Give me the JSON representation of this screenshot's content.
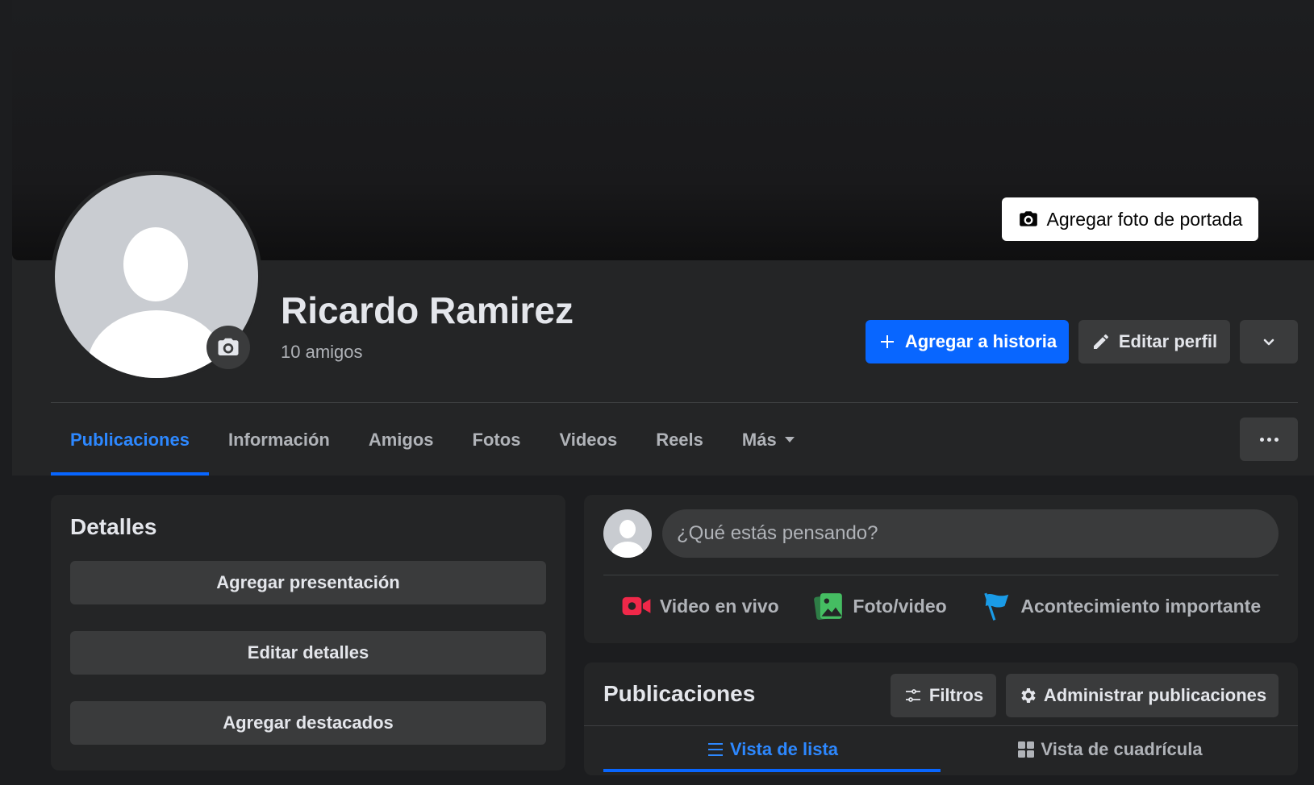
{
  "cover": {
    "add_cover_photo_label": "Agregar foto de portada"
  },
  "profile": {
    "name": "Ricardo Ramirez",
    "friends_count": "10 amigos"
  },
  "actions": {
    "add_to_story": "Agregar a historia",
    "edit_profile": "Editar perfil"
  },
  "tabs": [
    {
      "label": "Publicaciones",
      "active": true
    },
    {
      "label": "Información"
    },
    {
      "label": "Amigos"
    },
    {
      "label": "Fotos"
    },
    {
      "label": "Videos"
    },
    {
      "label": "Reels"
    },
    {
      "label": "Más"
    }
  ],
  "details": {
    "title": "Detalles",
    "buttons": [
      "Agregar presentación",
      "Editar detalles",
      "Agregar destacados"
    ]
  },
  "composer": {
    "placeholder": "¿Qué estás pensando?",
    "actions": [
      "Video en vivo",
      "Foto/video",
      "Acontecimiento importante"
    ]
  },
  "posts": {
    "title": "Publicaciones",
    "filters_label": "Filtros",
    "manage_label": "Administrar publicaciones",
    "list_view_label": "Vista de lista",
    "grid_view_label": "Vista de cuadrícula"
  },
  "colors": {
    "accent": "#0866ff",
    "background": "#1c1d1f",
    "card": "#242526",
    "button": "#3a3b3c",
    "live_icon": "#f02849",
    "photo_icon": "#45bd62",
    "flag_icon": "#1a9be6"
  },
  "icons": [
    "camera-icon",
    "plus-icon",
    "pencil-icon",
    "chevron-down-icon",
    "more-icon",
    "live-video-icon",
    "photo-icon",
    "flag-icon",
    "filter-icon",
    "gear-icon",
    "list-icon",
    "grid-icon"
  ]
}
